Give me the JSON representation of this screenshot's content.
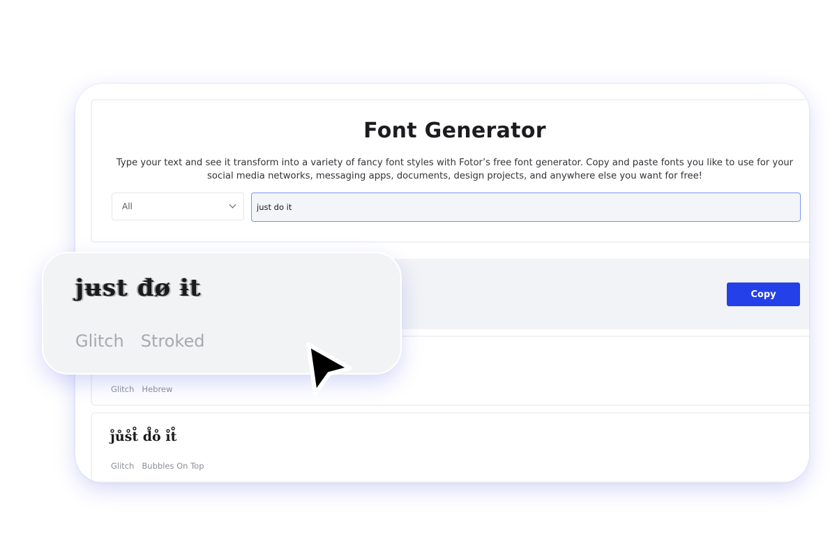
{
  "header": {
    "title": "Font Generator",
    "description": "Type your text and see it transform into a variety of fancy font styles with Fotor’s free font generator. Copy and paste fonts you like to use for your social media networks, messaging apps, documents, design projects, and anywhere else you want for free!"
  },
  "filter": {
    "selected": "All"
  },
  "input": {
    "value": "just do it"
  },
  "results": [
    {
      "sample": "",
      "tags": [],
      "copy_label": "Copy"
    },
    {
      "sample": "",
      "tags": [
        "Glitch",
        "Hebrew"
      ]
    },
    {
      "sample": "j̊ůs̊t̊ d̊o̊ i̊t̊",
      "tags": [
        "Glitch",
        "Bubbles On Top"
      ]
    }
  ],
  "zoom": {
    "sample": "jʉst đø ɨt",
    "tags": [
      "Glitch",
      "Stroked"
    ]
  },
  "colors": {
    "accent": "#2440e8",
    "input_border": "#7b93f0",
    "row_highlight": "#f1f3f6",
    "panel_glow": "#6e78e6"
  },
  "icons": [
    "chevron-down-icon",
    "mouse-pointer-icon"
  ]
}
